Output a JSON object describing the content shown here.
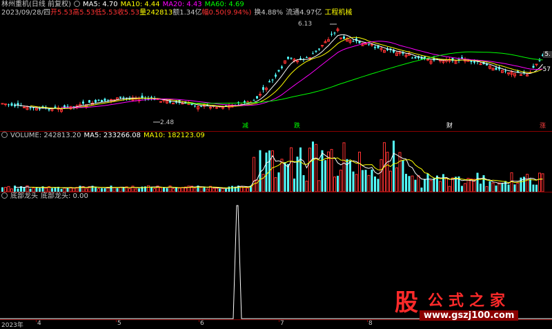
{
  "main_header": {
    "title": "林州重机(日线 前复权)",
    "ma5": "MA5: 4.70",
    "ma10": "MA10: 4.44",
    "ma20": "MA20: 4.43",
    "ma60": "MA60: 4.69"
  },
  "info_line": {
    "date": "2023/09/28/四",
    "open": "开5.53",
    "high": "高5.53",
    "low": "低5.53",
    "close": "收5.53",
    "volume": "量242813",
    "amount": "额1.34亿",
    "change": "幅0.50(9.94%)",
    "turnover": "换4.88%",
    "float": "流通4.97亿",
    "sector": "工程机械"
  },
  "price_annotations": {
    "high_label": "6.13",
    "low_label": "2.48"
  },
  "right_labels": {
    "top": "5.",
    "bottom": "57"
  },
  "event_markers": [
    {
      "text": "减",
      "color": "#00ff00"
    },
    {
      "text": "跌",
      "color": "#00ff00"
    },
    {
      "text": "财",
      "color": "#ffffff"
    },
    {
      "text": "涨",
      "color": "#ff4040"
    }
  ],
  "volume_header": {
    "label": "VOLUME: 242813.20",
    "ma5": "MA5: 233266.08",
    "ma10": "MA10: 182123.09"
  },
  "indicator_header": {
    "name": "底部龙头",
    "value_label": "底部龙头: 0.00"
  },
  "time_axis": {
    "labels": [
      "2023年",
      "4",
      "5",
      "6",
      "7",
      "8"
    ]
  },
  "watermark": {
    "logo": "股",
    "name": "公式之家",
    "url": "www.gszj100.com"
  },
  "colors": {
    "up": "#ff3232",
    "down": "#54ffff",
    "ma5": "#ffffff",
    "ma10": "#ffff00",
    "ma20": "#ff00ff",
    "ma60": "#00ff00",
    "divider": "#8b0000"
  }
}
